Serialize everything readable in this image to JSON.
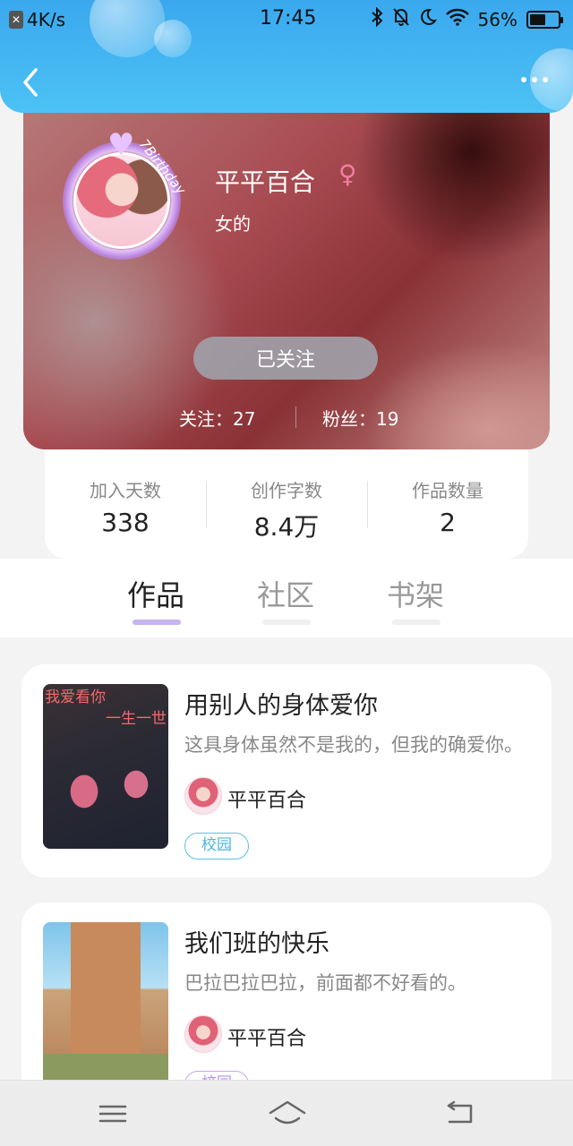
{
  "status_bar": {
    "network_speed": "4K/s",
    "time": "17:45",
    "battery_percent_text": "56%",
    "battery_level": 0.56,
    "icons": [
      "bluetooth-icon",
      "mute-icon",
      "moon-icon",
      "wifi-icon",
      "battery-icon"
    ]
  },
  "header": {
    "back_icon": "chevron-left-icon",
    "more_icon": "more-dots-icon",
    "accent_color": "#3aa8ee"
  },
  "profile": {
    "avatar_caption": "7Birthday",
    "username": "平平百合",
    "gender_symbol": "♀",
    "gender_label": "女的",
    "follow_button": "已关注",
    "following": "关注：27",
    "fans": "粉丝：19"
  },
  "stats": [
    {
      "label": "加入天数",
      "value": "338"
    },
    {
      "label": "创作字数",
      "value": "8.4万"
    },
    {
      "label": "作品数量",
      "value": "2"
    }
  ],
  "tabs": [
    {
      "label": "作品",
      "active": true
    },
    {
      "label": "社区",
      "active": false
    },
    {
      "label": "书架",
      "active": false
    }
  ],
  "works": [
    {
      "cover_text_1": "我爱看你",
      "cover_text_2": "一生一世",
      "title": "用别人的身体爱你",
      "description": "这具身体虽然不是我的，但我的确爱你。",
      "author": "平平百合",
      "tag": "校园"
    },
    {
      "title": "我们班的快乐",
      "description": "巴拉巴拉巴拉，前面都不好看的。",
      "author": "平平百合",
      "tag": "校园"
    }
  ],
  "bottom_nav": [
    {
      "icon": "menu-icon"
    },
    {
      "icon": "home-icon"
    },
    {
      "icon": "back-arrow-icon"
    }
  ]
}
